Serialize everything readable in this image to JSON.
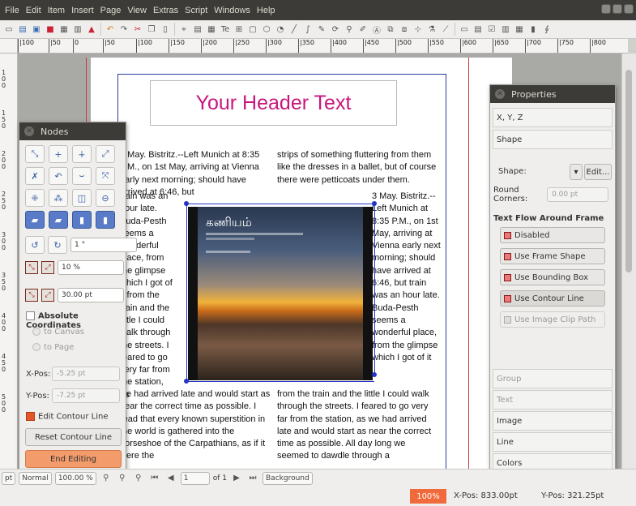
{
  "menu": [
    "File",
    "Edit",
    "Item",
    "Insert",
    "Page",
    "View",
    "Extras",
    "Script",
    "Windows",
    "Help"
  ],
  "ruler": {
    "h_ticks": [
      "|100",
      "|50",
      "0",
      "|50",
      "|100",
      "|150",
      "|200",
      "|250",
      "|300",
      "|350",
      "|400",
      "|450",
      "|500",
      "|550",
      "|600",
      "|650",
      "|700",
      "|750",
      "|800"
    ],
    "v_ticks": [
      "1 0 0",
      "1 5 0",
      "2 0 0",
      "2 5 0",
      "3 0 0",
      "3 5 0",
      "4 0 0",
      "4 5 0",
      "5 0 0"
    ]
  },
  "document": {
    "header": "Your Header Text",
    "col1_top": "3 May. Bistritz.--Left Munich at 8:35 P.M., on 1st May, arriving at Vienna early next morning; should have arrived at 6:46, but",
    "col1_wrap": "train was an hour late. Buda-Pesth seems a wonderful place, from the glimpse which I got of it from the train and the little I could walk through the streets. I feared to go very far from the station, as",
    "col1_bottom": "we had arrived late and would start as near the correct time as possible. I read that every known superstition in the world is gathered into the horseshoe of the Carpathians, as if it were the",
    "col2_top": "strips of something fluttering from them like the dresses in a ballet, but of course there were petticoats under them.",
    "col2_wrap": "3 May. Bistritz.--Left Munich at 8:35 P.M., on 1st May, arriving at Vienna early next morning; should have arrived at 6:46, but train was an hour late. Buda-Pesth seems a wonderful place, from the glimpse which I got of it",
    "col2_bottom": "from the train and the little I could walk through the streets. I feared to go very far from the station, as we had arrived late and would start as near the correct time as possible. All day long we seemed to dawdle through a",
    "image_title": "கணியம்"
  },
  "nodes_panel": {
    "title": "Nodes",
    "rotate_value": "1 °",
    "scale_percent": "10 %",
    "scale_pt": "30.00 pt",
    "absolute_coords": "Absolute Coordinates",
    "to_canvas": "to Canvas",
    "to_page": "to Page",
    "xpos_label": "X-Pos:",
    "xpos_value": "-5.25 pt",
    "ypos_label": "Y-Pos:",
    "ypos_value": "-7.25 pt",
    "edit_contour": "Edit Contour Line",
    "reset_contour": "Reset Contour Line",
    "end_editing": "End Editing"
  },
  "properties": {
    "title": "Properties",
    "xyz": "X, Y, Z",
    "shape": "Shape",
    "shape_label": "Shape:",
    "edit_btn": "Edit...",
    "round_corners": "Round Corners:",
    "round_value": "0.00 pt",
    "flow_heading": "Text Flow Around Frame",
    "flow_options": [
      "Disabled",
      "Use Frame Shape",
      "Use Bounding Box",
      "Use Contour Line",
      "Use Image Clip Path"
    ],
    "sections": [
      "Group",
      "Text",
      "Image",
      "Line",
      "Colors"
    ]
  },
  "bottombar": {
    "unit": "pt",
    "mode": "Normal",
    "zoom": "100.00 %",
    "page": "1",
    "of_pages": "of 1",
    "layer": "Background"
  },
  "status": {
    "zoom": "100%",
    "xpos": "X-Pos: 833.00pt",
    "ypos": "Y-Pos: 321.25pt"
  },
  "colors": {
    "accent": "#f06a3c",
    "header": "#c8177f",
    "selection": "#2433c8"
  }
}
